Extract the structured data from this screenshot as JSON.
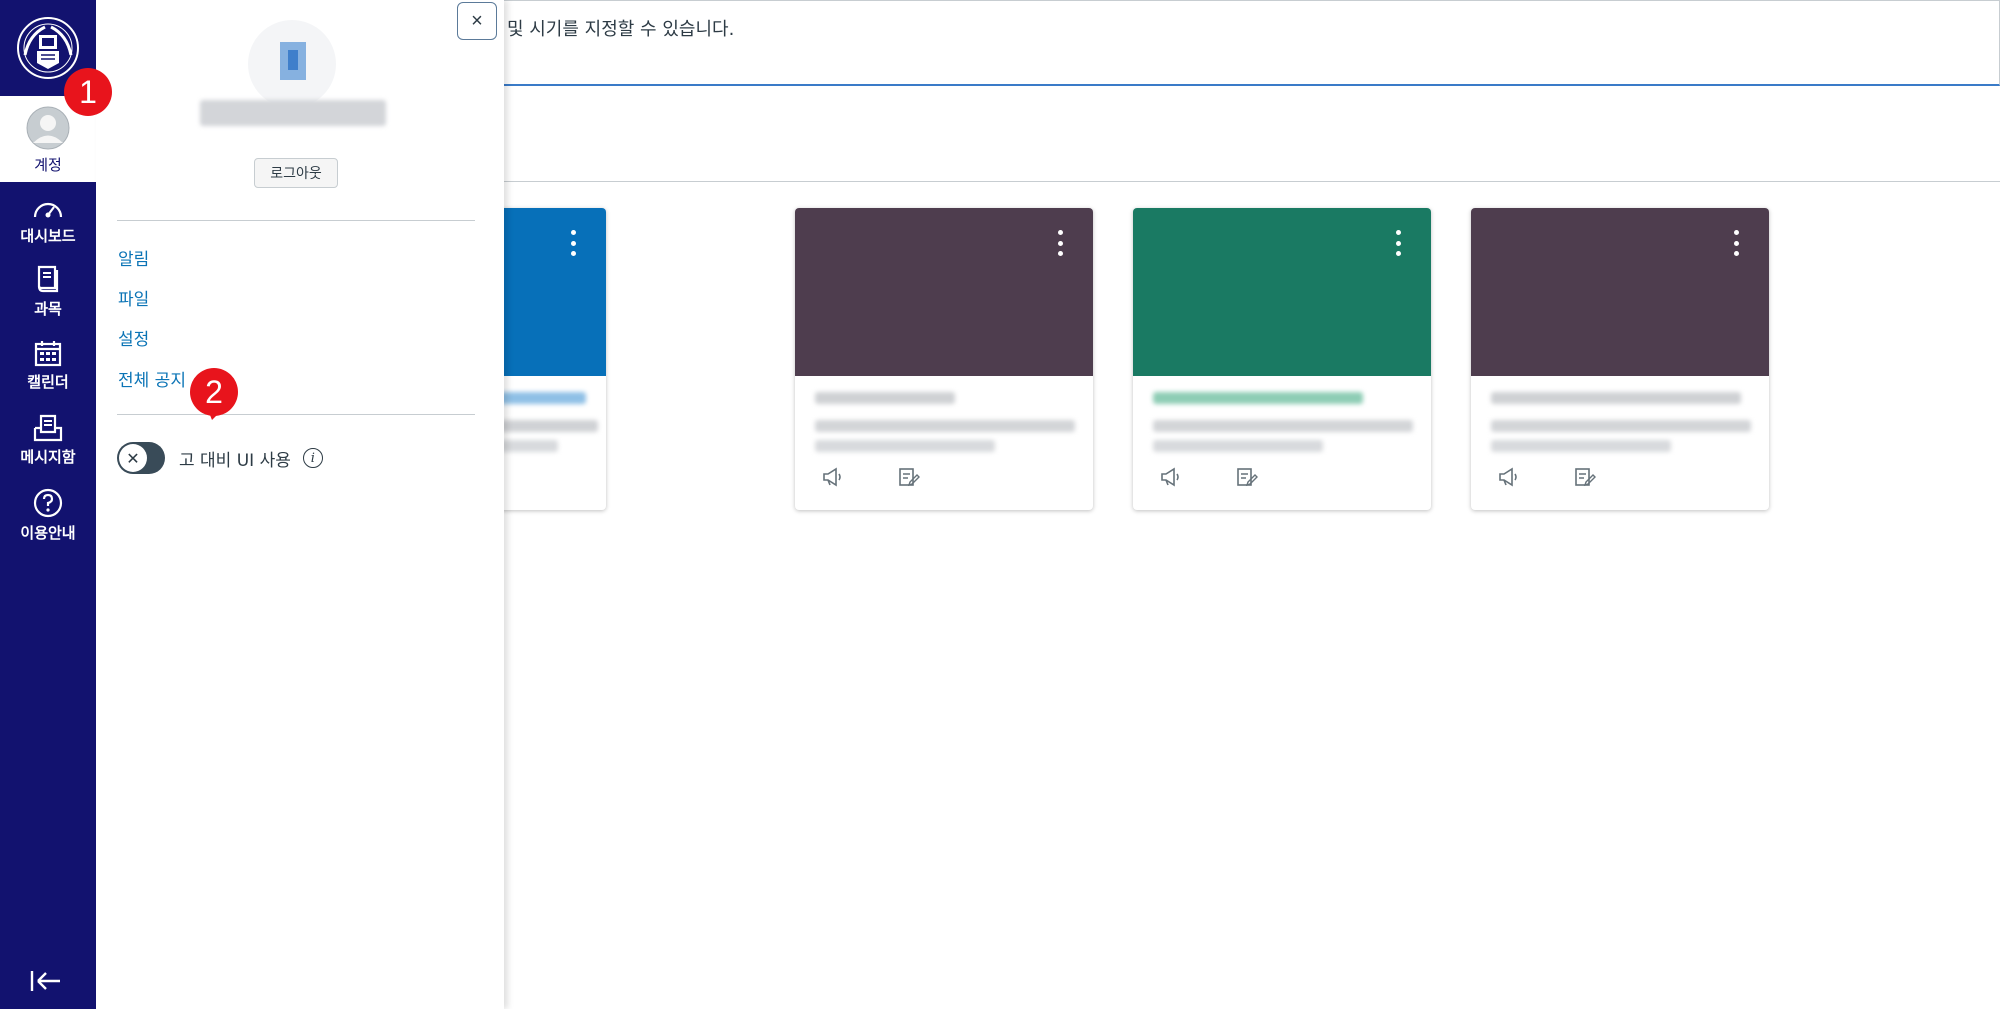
{
  "global_nav": {
    "account_label": "계정",
    "items": [
      {
        "label": "대시보드",
        "icon": "dashboard-icon"
      },
      {
        "label": "과목",
        "icon": "courses-icon"
      },
      {
        "label": "캘린더",
        "icon": "calendar-icon"
      },
      {
        "label": "메시지함",
        "icon": "inbox-icon"
      },
      {
        "label": "이용안내",
        "icon": "help-icon"
      }
    ],
    "colors": {
      "nav_bg": "#12126f",
      "badge": "#e8141c"
    }
  },
  "annotations": {
    "badge_1": "1",
    "badge_2": "2"
  },
  "account_tray": {
    "close_label": "×",
    "logout_label": "로그아웃",
    "links": [
      "알림",
      "파일",
      "설정",
      "전체 공지"
    ],
    "high_contrast_label": "고 대비 UI 사용",
    "high_contrast_enabled": false
  },
  "notice": {
    "text": "한 알림 여부 및 시기를 지정할 수 있습니다."
  },
  "cards": [
    {
      "color": "#0770b9",
      "icons": [
        "announcement-icon",
        "assignment-icon"
      ]
    },
    {
      "color": "#4e3d4e",
      "icons": [
        "announcement-icon",
        "assignment-icon"
      ]
    },
    {
      "color": "#1a7a63",
      "icons": [
        "announcement-icon",
        "assignment-icon"
      ]
    },
    {
      "color": "#4e3d4e",
      "icons": [
        "announcement-icon",
        "assignment-icon"
      ]
    }
  ]
}
